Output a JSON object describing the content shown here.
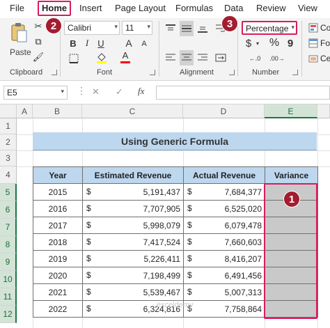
{
  "ribbon_tabs": [
    "File",
    "Home",
    "Insert",
    "Page Layout",
    "Formulas",
    "Data",
    "Review",
    "View"
  ],
  "clipboard": {
    "paste_label": "Paste",
    "group_label": "Clipboard"
  },
  "font": {
    "name": "Calibri",
    "size": "11",
    "group_label": "Font",
    "bold": "B",
    "italic": "I",
    "underline": "U",
    "grow": "A",
    "shrink": "A",
    "font_color": "A"
  },
  "alignment": {
    "group_label": "Alignment"
  },
  "number": {
    "format": "Percentage",
    "group_label": "Number",
    "currency": "$",
    "percent": "%",
    "comma": "9"
  },
  "styles_partial": [
    "Co",
    "Fo",
    "Ce"
  ],
  "badges": {
    "b1": "1",
    "b2": "2",
    "b3": "3"
  },
  "formula_bar": {
    "name_box": "E5",
    "cancel": "✕",
    "enter": "✓",
    "fx": "fx"
  },
  "columns": [
    "A",
    "B",
    "C",
    "D",
    "E"
  ],
  "rows": [
    "1",
    "2",
    "3",
    "4",
    "5",
    "6",
    "7",
    "8",
    "9",
    "10",
    "11",
    "12"
  ],
  "title": "Using Generic Formula",
  "table": {
    "headers": [
      "Year",
      "Estimated Revenue",
      "Actual Revenue",
      "Variance"
    ],
    "currency": "$",
    "rows": [
      {
        "year": "2015",
        "estimated": "5,191,437",
        "actual": "7,684,377"
      },
      {
        "year": "2016",
        "estimated": "7,707,905",
        "actual": "6,525,020"
      },
      {
        "year": "2017",
        "estimated": "5,998,079",
        "actual": "6,079,478"
      },
      {
        "year": "2018",
        "estimated": "7,417,524",
        "actual": "7,660,603"
      },
      {
        "year": "2019",
        "estimated": "5,226,411",
        "actual": "8,416,207"
      },
      {
        "year": "2020",
        "estimated": "7,198,499",
        "actual": "6,491,456"
      },
      {
        "year": "2021",
        "estimated": "5,539,467",
        "actual": "5,007,313"
      },
      {
        "year": "2022",
        "estimated": "6,324,816",
        "actual": "7,758,864"
      }
    ]
  },
  "watermark": "exceldemy",
  "colors": {
    "accent": "#d81b60",
    "badge": "#a31c2f",
    "header_fill": "#bdd7ee",
    "selected_fill": "#c9c9c9",
    "excel_green": "#217346"
  }
}
